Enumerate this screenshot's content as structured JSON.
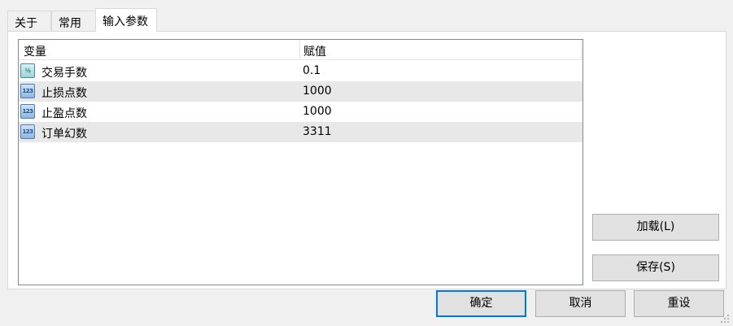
{
  "tabs": [
    {
      "label": "关于"
    },
    {
      "label": "常用"
    },
    {
      "label": "输入参数",
      "active": true
    }
  ],
  "grid": {
    "headers": {
      "name": "变量",
      "value": "赋值"
    },
    "rows": [
      {
        "icon": "fraction-icon",
        "icon_text": "½",
        "name": "交易手数",
        "value": "0.1"
      },
      {
        "icon": "integer-icon",
        "icon_text": "123",
        "name": "止损点数",
        "value": "1000"
      },
      {
        "icon": "integer-icon",
        "icon_text": "123",
        "name": "止盈点数",
        "value": "1000"
      },
      {
        "icon": "integer-icon",
        "icon_text": "123",
        "name": "订单幻数",
        "value": "3311"
      }
    ]
  },
  "side_buttons": {
    "load": "加载(L)",
    "save": "保存(S)"
  },
  "footer_buttons": {
    "ok": "确定",
    "cancel": "取消",
    "reset": "重设"
  },
  "colors": {
    "accent": "#0078d7",
    "row_alt": "#e8e8e8",
    "button_bg": "#e1e1e1"
  }
}
